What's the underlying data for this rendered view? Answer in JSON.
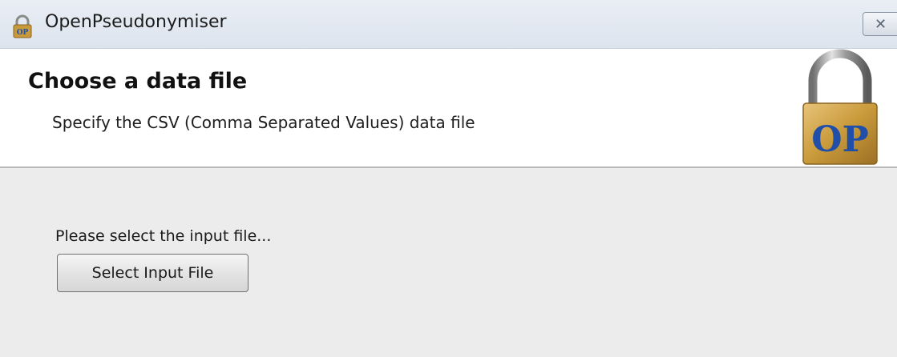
{
  "window": {
    "title": "OpenPseudonymiser",
    "close_glyph": "✕",
    "app_icon": "padlock-icon"
  },
  "header": {
    "title": "Choose a data file",
    "subtitle": "Specify the CSV (Comma Separated Values) data file",
    "logo_text": "OP",
    "logo_icon": "padlock-logo"
  },
  "content": {
    "prompt": "Please select the input file...",
    "select_button_label": "Select Input File"
  },
  "colors": {
    "logo_text": "#1f4fa8",
    "padlock_body": "#c99a3a",
    "content_background": "#ececec"
  }
}
